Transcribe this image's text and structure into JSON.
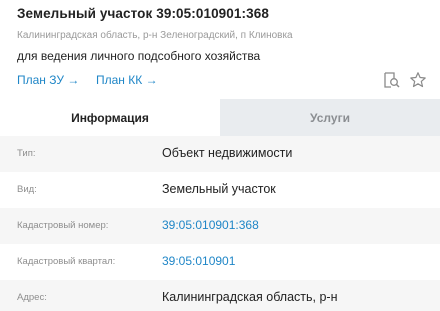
{
  "header": {
    "title": "Земельный участок 39:05:010901:368",
    "address": "Калининградская область, р-н Зеленоградский, п Клиновка",
    "purpose": "для ведения личного подсобного хозяйства",
    "plan_zu": "План ЗУ →",
    "plan_kk": "План КК →",
    "icons": [
      "zoom-doc-icon",
      "star-icon"
    ]
  },
  "tabs": {
    "info": "Информация",
    "services": "Услуги"
  },
  "details": {
    "type_label": "Тип:",
    "type_value": "Объект недвижимости",
    "kind_label": "Вид:",
    "kind_value": "Земельный участок",
    "cad_num_label": "Кадастровый номер:",
    "cad_num_value": "39:05:010901:368",
    "cad_block_label": "Кадастровый квартал:",
    "cad_block_value": "39:05:010901",
    "address_label": "Адрес:",
    "address_value": "Калининградская область, р-н"
  },
  "colors": {
    "link": "#1f86c7",
    "muted": "#8e8e8e",
    "tab_inactive_bg": "#e9ecef"
  }
}
